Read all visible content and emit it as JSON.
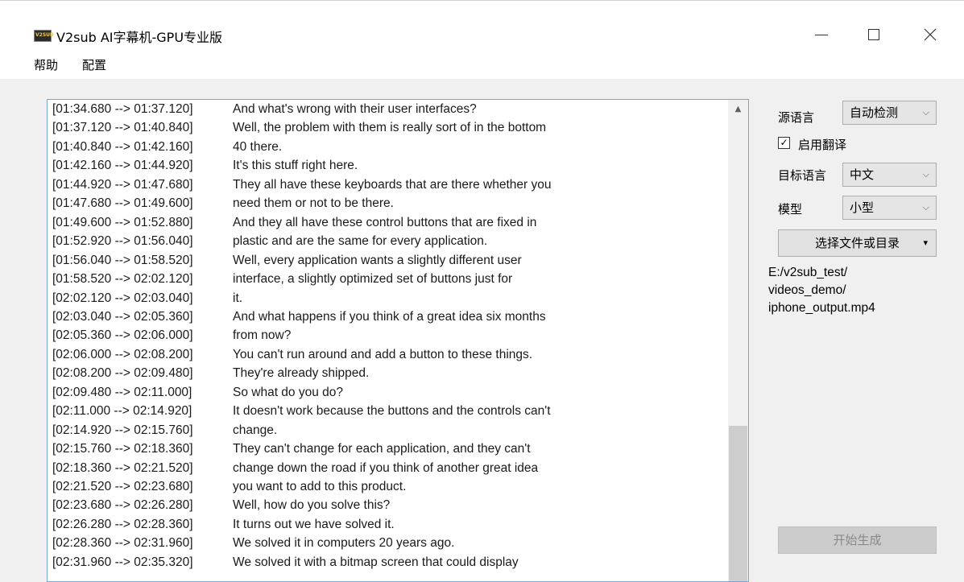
{
  "window": {
    "title": "V2sub AI字幕机-GPU专业版",
    "icon_text": "V2SUB"
  },
  "menu": {
    "help": "帮助",
    "config": "配置"
  },
  "log": [
    {
      "time": "[01:34.680 --> 01:37.120]",
      "text": "And what's wrong with their user interfaces?"
    },
    {
      "time": "[01:37.120 --> 01:40.840]",
      "text": "Well, the problem with them is really sort of in the bottom"
    },
    {
      "time": "[01:40.840 --> 01:42.160]",
      "text": "40 there."
    },
    {
      "time": "[01:42.160 --> 01:44.920]",
      "text": "It's this stuff right here."
    },
    {
      "time": "[01:44.920 --> 01:47.680]",
      "text": "They all have these keyboards that are there whether you"
    },
    {
      "time": "[01:47.680 --> 01:49.600]",
      "text": "need them or not to be there."
    },
    {
      "time": "[01:49.600 --> 01:52.880]",
      "text": "And they all have these control buttons that are fixed in"
    },
    {
      "time": "[01:52.920 --> 01:56.040]",
      "text": "plastic and are the same for every application."
    },
    {
      "time": "[01:56.040 --> 01:58.520]",
      "text": "Well, every application wants a slightly different user"
    },
    {
      "time": "[01:58.520 --> 02:02.120]",
      "text": "interface, a slightly optimized set of buttons just for"
    },
    {
      "time": "[02:02.120 --> 02:03.040]",
      "text": "it."
    },
    {
      "time": "[02:03.040 --> 02:05.360]",
      "text": "And what happens if you think of a great idea six months"
    },
    {
      "time": "[02:05.360 --> 02:06.000]",
      "text": "from now?"
    },
    {
      "time": "[02:06.000 --> 02:08.200]",
      "text": "You can't run around and add a button to these things."
    },
    {
      "time": "[02:08.200 --> 02:09.480]",
      "text": "They're already shipped."
    },
    {
      "time": "[02:09.480 --> 02:11.000]",
      "text": "So what do you do?"
    },
    {
      "time": "[02:11.000 --> 02:14.920]",
      "text": "It doesn't work because the buttons and the controls can't"
    },
    {
      "time": "[02:14.920 --> 02:15.760]",
      "text": "change."
    },
    {
      "time": "[02:15.760 --> 02:18.360]",
      "text": "They can't change for each application, and they can't"
    },
    {
      "time": "[02:18.360 --> 02:21.520]",
      "text": "change down the road if you think of another great idea"
    },
    {
      "time": "[02:21.520 --> 02:23.680]",
      "text": "you want to add to this product."
    },
    {
      "time": "[02:23.680 --> 02:26.280]",
      "text": "Well, how do you solve this?"
    },
    {
      "time": "[02:26.280 --> 02:28.360]",
      "text": "It turns out we have solved it."
    },
    {
      "time": "[02:28.360 --> 02:31.960]",
      "text": "We solved it in computers 20 years ago."
    },
    {
      "time": "[02:31.960 --> 02:35.320]",
      "text": "We solved it with a bitmap screen that could display"
    }
  ],
  "settings": {
    "source_language_label": "源语言",
    "source_language_value": "自动检测",
    "enable_translation_label": "启用翻译",
    "enable_translation_checked": "✓",
    "target_language_label": "目标语言",
    "target_language_value": "中文",
    "model_label": "模型",
    "model_value": "小型",
    "select_button": "选择文件或目录",
    "path_lines": [
      "E:/v2sub_test/",
      "videos_demo/",
      "iphone_output.mp4"
    ],
    "start_button": "开始生成"
  },
  "icons": {
    "chevron": "⌵",
    "dropdown": "▾",
    "scroll_up": "▲"
  }
}
